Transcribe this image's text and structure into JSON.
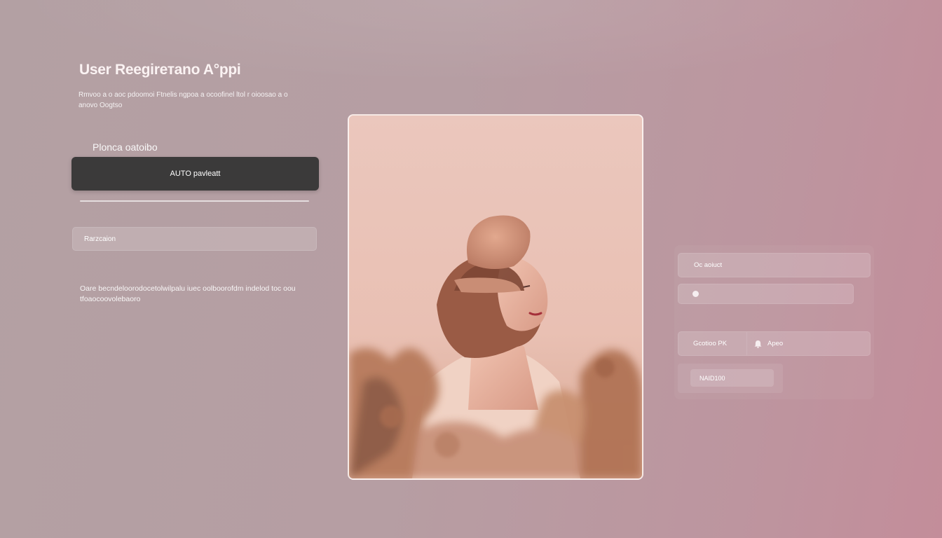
{
  "app": {
    "title": "User Reegirетano A°ppi",
    "subtitle": "Rmvoo a o aoc pdoomoi Ftnelis ngpoa a ocoofinel ltol r oioosao a o anovo Oogtso"
  },
  "form": {
    "section_label": "Plonca oatoibo",
    "primary_button_label": "AUTO pavleatt",
    "text_field_value": "Rarzcaion",
    "body_text": "Oare becndeloorodocetolwilpalu iuec oolboorofdm indelod toc oou tfoaocoovolebaoro"
  },
  "right_panel": {
    "field1_value": "Oc aoiuct",
    "segment_label": "Gcotioo PK",
    "segment_value": "Apeo",
    "small_field_value": "NAID100"
  },
  "colors": {
    "background": "#b69ea3",
    "primary_button": "#3b3a3a",
    "card_border": "#ffffff"
  }
}
